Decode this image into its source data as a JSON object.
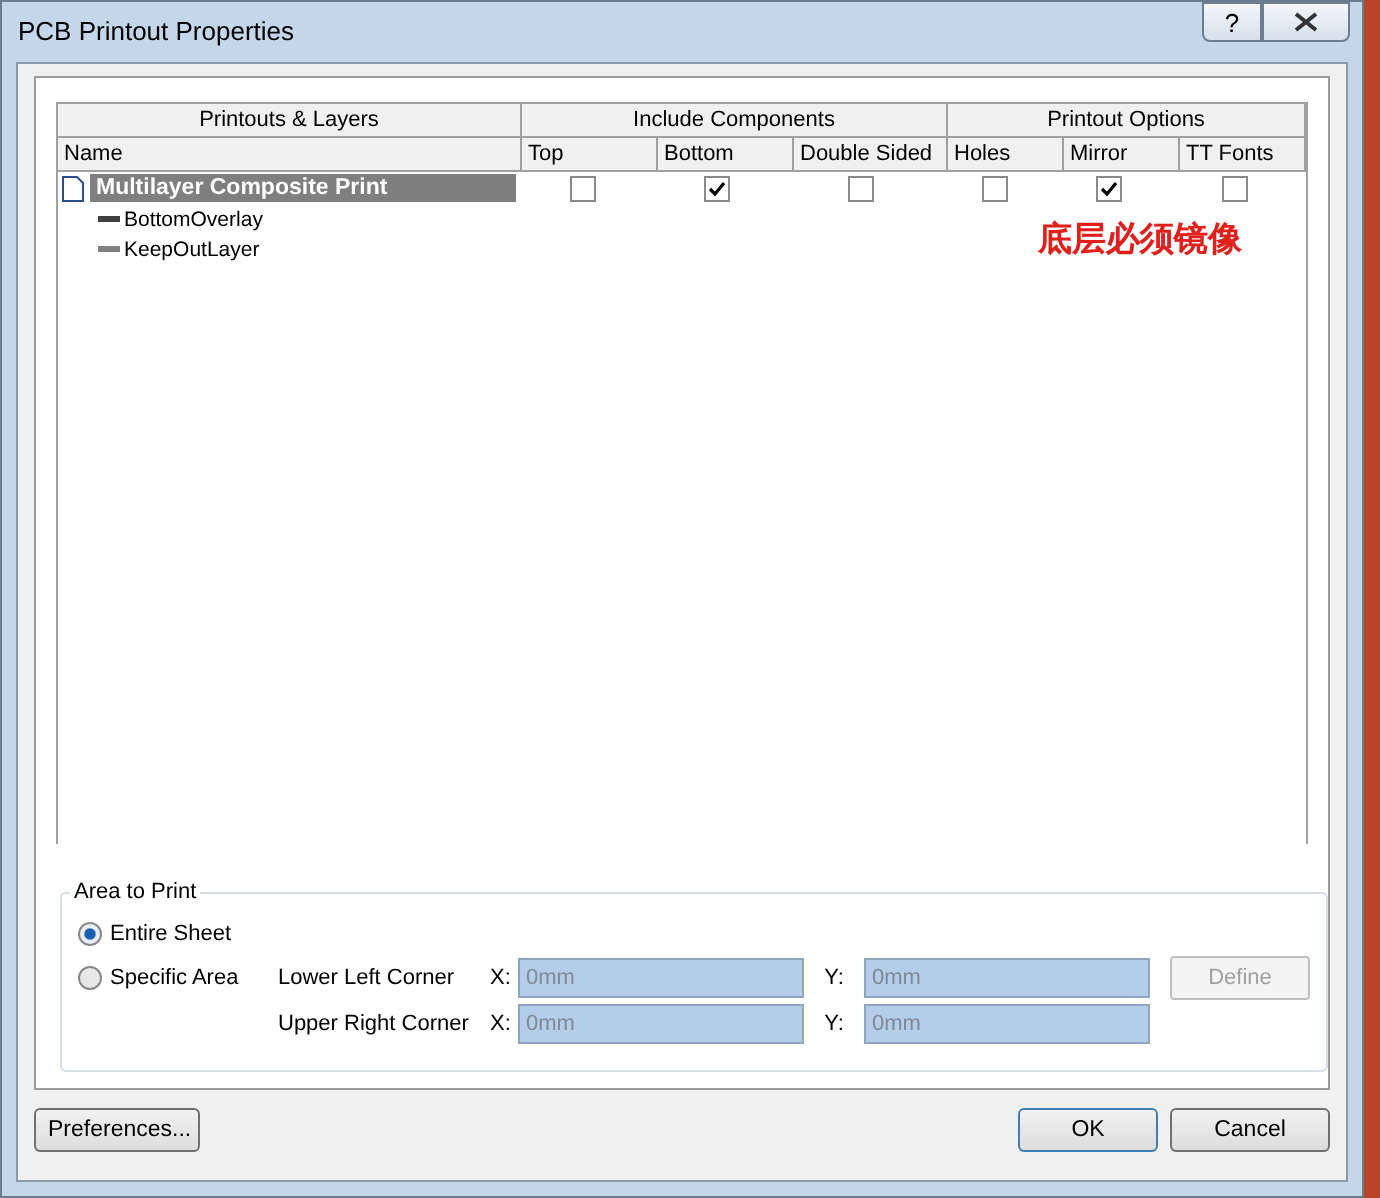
{
  "window": {
    "title": "PCB Printout Properties",
    "help_label": "?"
  },
  "table": {
    "groups": [
      {
        "label": "Printouts & Layers",
        "columns": [
          "Name"
        ]
      },
      {
        "label": "Include Components",
        "columns": [
          "Top",
          "Bottom",
          "Double Sided"
        ]
      },
      {
        "label": "Printout Options",
        "columns": [
          "Holes",
          "Mirror",
          "TT Fonts"
        ]
      }
    ],
    "rows": [
      {
        "name": "Multilayer Composite Print",
        "selected": true,
        "checks": [
          {
            "checked": false
          },
          {
            "checked": true
          },
          {
            "checked": false
          },
          {
            "checked": false
          },
          {
            "checked": true
          },
          {
            "checked": false
          }
        ],
        "children": [
          {
            "name": "BottomOverlay",
            "color": "#404040"
          },
          {
            "name": "KeepOutLayer",
            "color": "#808080"
          }
        ]
      }
    ],
    "note": "底层必须镜像"
  },
  "area": {
    "title": "Area to Print",
    "options": [
      {
        "label": "Entire Sheet",
        "selected": true
      },
      {
        "label": "Specific Area",
        "selected": false
      }
    ],
    "corners": [
      {
        "label": "Lower Left Corner",
        "x_label": "X:",
        "x_value": "0mm",
        "y_label": "Y:",
        "y_value": "0mm"
      },
      {
        "label": "Upper Right Corner",
        "x_label": "X:",
        "x_value": "0mm",
        "y_label": "Y:",
        "y_value": "0mm"
      }
    ],
    "define": {
      "label": "Define",
      "disabled": true
    }
  },
  "footer": {
    "preferences": "Preferences...",
    "ok": "OK",
    "cancel": "Cancel"
  }
}
